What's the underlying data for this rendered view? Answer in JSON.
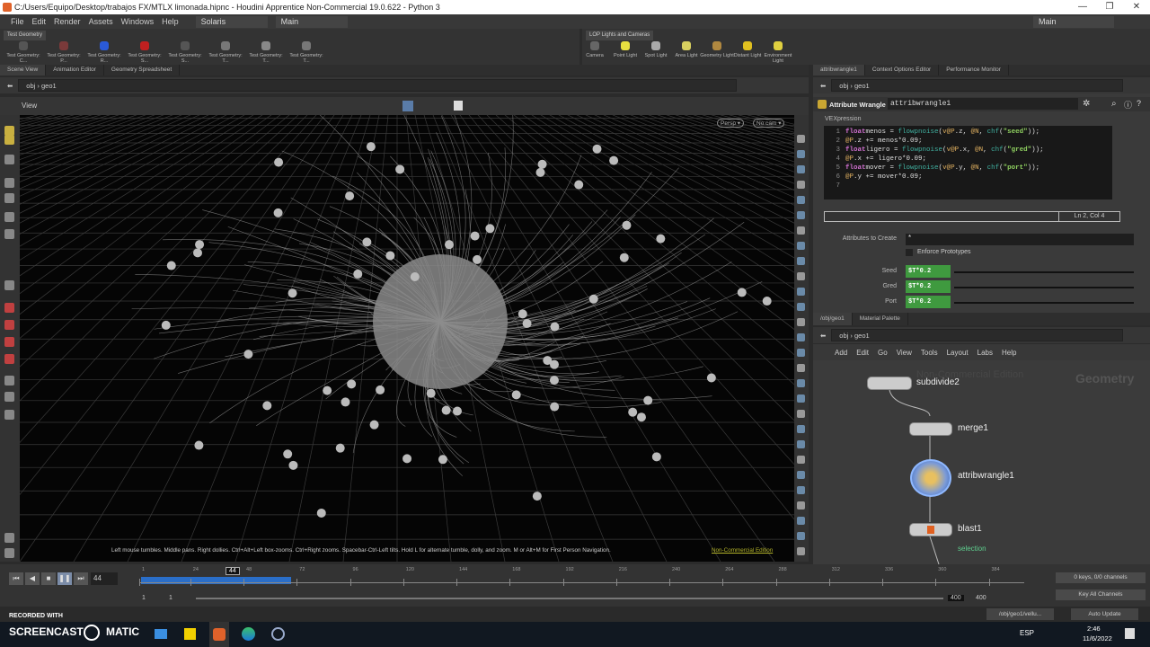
{
  "window": {
    "title": "C:/Users/Equipo/Desktop/trabajos FX/MTLX limonada.hipnc - Houdini Apprentice Non-Commercial 19.0.622 - Python 3",
    "minimize": "—",
    "restore": "❐",
    "close": "✕"
  },
  "menu": [
    "File",
    "Edit",
    "Render",
    "Assets",
    "Windows",
    "Help"
  ],
  "desktop": "Solaris",
  "workspace": "Main",
  "workspace_right": "Main",
  "shelf_left": {
    "tab": "Test Geometry",
    "tools": [
      "Test Geometry: C...",
      "Test Geometry: P...",
      "Test Geometry: R...",
      "Test Geometry: S...",
      "Test Geometry: S...",
      "Test Geometry: T...",
      "Test Geometry: T...",
      "Test Geometry: T..."
    ]
  },
  "shelf_right": {
    "tab": "LOP Lights and Cameras",
    "tools": [
      "Camera",
      "Point Light",
      "Spot Light",
      "Area Light",
      "Geometry Light",
      "Distant Light",
      "Environment Light"
    ]
  },
  "left_tabs": [
    "Scene View",
    "Animation Editor",
    "Geometry Spreadsheet"
  ],
  "right_tabs": [
    "attribwrangle1",
    "Context Options Editor",
    "Performance Monitor"
  ],
  "path": {
    "root": "obj",
    "node": "geo1"
  },
  "viewport": {
    "label": "View",
    "persp": "Persp ▾",
    "cam": "No cam ▾",
    "hint": "Left mouse tumbles. Middle pans. Right dollies. Ctrl+Alt+Left box-zooms. Ctrl+Right zooms. Spacebar-Ctrl-Left tilts. Hold L for alternate tumble, dolly, and zoom.    M or Alt+M for First Person Navigation.",
    "edition": "Non-Commercial Edition"
  },
  "params": {
    "node_type": "Attribute Wrangle",
    "node_name": "attribwrangle1",
    "section": "VEXpression",
    "status": "Ln 2, Col 4",
    "code": [
      [
        [
          "kw",
          "float"
        ],
        [
          "",
          "menos = "
        ],
        [
          "fn",
          "flowpnoise"
        ],
        [
          "",
          "("
        ],
        [
          "at",
          "v@P"
        ],
        [
          "",
          ".z, "
        ],
        [
          "at",
          "@N"
        ],
        [
          "",
          ", "
        ],
        [
          "fn",
          "chf"
        ],
        [
          "",
          "("
        ],
        [
          "st",
          "\"seed\""
        ],
        [
          "",
          "));"
        ]
      ],
      [
        [
          "at",
          "@P"
        ],
        [
          "",
          ".z += menos*0.09;"
        ]
      ],
      [
        [
          "kw",
          "float"
        ],
        [
          "",
          "ligero = "
        ],
        [
          "fn",
          "flowpnoise"
        ],
        [
          "",
          "("
        ],
        [
          "at",
          "v@P"
        ],
        [
          "",
          ".x, "
        ],
        [
          "at",
          "@N"
        ],
        [
          "",
          ", "
        ],
        [
          "fn",
          "chf"
        ],
        [
          "",
          "("
        ],
        [
          "st",
          "\"gred\""
        ],
        [
          "",
          "));"
        ]
      ],
      [
        [
          "at",
          "@P"
        ],
        [
          "",
          ".x += ligero*0.09;"
        ]
      ],
      [
        [
          "kw",
          "float"
        ],
        [
          "",
          "mover = "
        ],
        [
          "fn",
          "flowpnoise"
        ],
        [
          "",
          "("
        ],
        [
          "at",
          "v@P"
        ],
        [
          "",
          ".y, "
        ],
        [
          "at",
          "@N"
        ],
        [
          "",
          ", "
        ],
        [
          "fn",
          "chf"
        ],
        [
          "",
          "("
        ],
        [
          "st",
          "\"port\""
        ],
        [
          "",
          "));"
        ]
      ],
      [
        [
          "at",
          "@P"
        ],
        [
          "",
          ".y += mover*0.09;"
        ]
      ],
      []
    ],
    "attributes_label": "Attributes to Create",
    "attributes_value": "*",
    "enforce": "Enforce Prototypes",
    "fields": [
      {
        "label": "Seed",
        "value": "$T*0.2"
      },
      {
        "label": "Gred",
        "value": "$T*0.2"
      },
      {
        "label": "Port",
        "value": "$T*0.2"
      }
    ]
  },
  "network": {
    "tabs": [
      "/obj/geo1",
      "Material Palette"
    ],
    "menu": [
      "Add",
      "Edit",
      "Go",
      "View",
      "Tools",
      "Layout",
      "Labs",
      "Help"
    ],
    "watermark": "Geometry",
    "watermark2": "Non-Commercial Edition",
    "nodes": [
      {
        "name": "subdivide2"
      },
      {
        "name": "merge1"
      },
      {
        "name": "attribwrangle1"
      },
      {
        "name": "blast1",
        "sub": "selection"
      }
    ]
  },
  "timeline": {
    "frame": "44",
    "marker": "44",
    "ticks": [
      "1",
      "24",
      "48",
      "72",
      "96",
      "120",
      "144",
      "168",
      "192",
      "216",
      "240",
      "264",
      "288",
      "312",
      "336",
      "360",
      "384"
    ],
    "start": "1",
    "start2": "1",
    "end": "400",
    "end2": "400",
    "keys": "0 keys, 0/0 channels",
    "key_all": "Key All Channels",
    "progress": 0.17
  },
  "status": {
    "path": "/obj/geo1/vellu...",
    "update": "Auto Update"
  },
  "taskbar": {
    "recorded": "RECORDED WITH",
    "brand": "SCREENCAST",
    "brand2": "MATIC",
    "lang": "ESP",
    "time": "2:46",
    "date": "11/6/2022"
  }
}
